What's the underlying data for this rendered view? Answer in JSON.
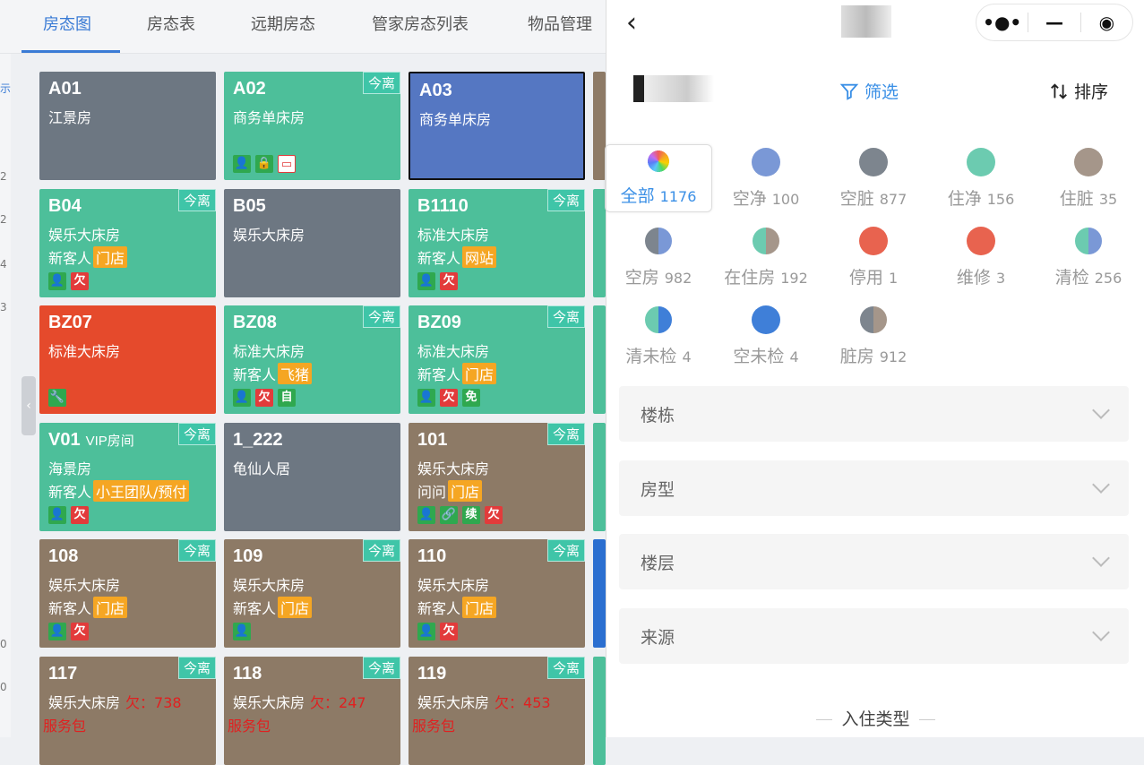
{
  "tabs": [
    {
      "label": "房态图",
      "active": true
    },
    {
      "label": "房态表"
    },
    {
      "label": "远期房态"
    },
    {
      "label": "管家房态列表"
    },
    {
      "label": "物品管理"
    }
  ],
  "left_strip_marks": [
    "示",
    "2",
    "2",
    "4",
    "3",
    "0",
    "0"
  ],
  "rooms": [
    {
      "no": "A01",
      "type": "江景房",
      "color": "gray"
    },
    {
      "no": "A02",
      "type": "商务单床房",
      "color": "green",
      "today": "今离",
      "icons": [
        "person",
        "lock",
        "card"
      ]
    },
    {
      "no": "A03",
      "type": "商务单床房",
      "color": "blue"
    },
    {
      "no": "B04",
      "type": "娱乐大床房",
      "color": "green",
      "today": "今离",
      "guest": "新客人",
      "source": "门店",
      "icons": [
        "person",
        "欠"
      ]
    },
    {
      "no": "B05",
      "type": "娱乐大床房",
      "color": "gray"
    },
    {
      "no": "B1110",
      "type": "标准大床房",
      "color": "green",
      "today": "今离",
      "guest": "新客人",
      "source": "网站",
      "icons": [
        "person",
        "欠"
      ]
    },
    {
      "no": "BZ07",
      "type": "标准大床房",
      "color": "red",
      "icons": [
        "wrench"
      ]
    },
    {
      "no": "BZ08",
      "type": "标准大床房",
      "color": "green",
      "today": "今离",
      "guest": "新客人",
      "source": "飞猪",
      "icons": [
        "person",
        "欠",
        "自"
      ]
    },
    {
      "no": "BZ09",
      "type": "标准大床房",
      "color": "green",
      "today": "今离",
      "guest": "新客人",
      "source": "门店",
      "icons": [
        "person",
        "欠",
        "免"
      ]
    },
    {
      "no": "V01",
      "no_sub": "VIP房间",
      "type": "海景房",
      "color": "green",
      "today": "今离",
      "guest": "新客人",
      "source": "小王团队/预付",
      "icons": [
        "person",
        "欠"
      ]
    },
    {
      "no": "1_222",
      "type": "龟仙人居",
      "color": "gray"
    },
    {
      "no": "101",
      "type": "娱乐大床房",
      "color": "brown",
      "today": "今离",
      "guest": "问问",
      "source": "门店",
      "icons": [
        "person",
        "link",
        "续",
        "欠"
      ]
    },
    {
      "no": "108",
      "type": "娱乐大床房",
      "color": "brown",
      "today": "今离",
      "guest": "新客人",
      "source": "门店",
      "icons": [
        "person",
        "欠"
      ]
    },
    {
      "no": "109",
      "type": "娱乐大床房",
      "color": "brown",
      "today": "今离",
      "guest": "新客人",
      "source": "门店",
      "icons": [
        "person"
      ]
    },
    {
      "no": "110",
      "type": "娱乐大床房",
      "color": "brown",
      "today": "今离",
      "guest": "新客人",
      "source": "门店",
      "icons": [
        "person",
        "欠"
      ]
    },
    {
      "no": "117",
      "type": "娱乐大床房",
      "color": "brown",
      "today": "今离",
      "debt": "欠：738",
      "package": "服务包"
    },
    {
      "no": "118",
      "type": "娱乐大床房",
      "color": "brown",
      "today": "今离",
      "debt": "欠：247",
      "package": "服务包"
    },
    {
      "no": "119",
      "type": "娱乐大床房",
      "color": "brown",
      "today": "今离",
      "debt": "欠：453",
      "package": "服务包"
    }
  ],
  "panel": {
    "filter_label": "筛选",
    "sort_label": "排序",
    "statuses": [
      {
        "label": "全部",
        "count": "1176",
        "selected": true,
        "dot": "rainbow"
      },
      {
        "label": "空净",
        "count": "100",
        "dot": "#7a98d6"
      },
      {
        "label": "空脏",
        "count": "877",
        "dot": "#7d858e"
      },
      {
        "label": "住净",
        "count": "156",
        "dot": "#6ccbb0"
      },
      {
        "label": "住脏",
        "count": "35",
        "dot": "#a5968a"
      },
      {
        "label": "空房",
        "count": "982",
        "dot": "split:#7d858e:#7a98d6"
      },
      {
        "label": "在住房",
        "count": "192",
        "dot": "split:#6ccbb0:#a5968a"
      },
      {
        "label": "停用",
        "count": "1",
        "dot": "#e8634f"
      },
      {
        "label": "维修",
        "count": "3",
        "dot": "#e8634f"
      },
      {
        "label": "清检",
        "count": "256",
        "dot": "split:#6ccbb0:#7a98d6"
      },
      {
        "label": "清未检",
        "count": "4",
        "dot": "split:#6ccbb0:#3f7fd8"
      },
      {
        "label": "空未检",
        "count": "4",
        "dot": "#3f7fd8"
      },
      {
        "label": "脏房",
        "count": "912",
        "dot": "split:#7d858e:#a5968a"
      }
    ],
    "accordions": [
      "楼栋",
      "房型",
      "楼层",
      "来源"
    ],
    "checkin_type_label": "入住类型",
    "capsule": {
      "more": "•●•",
      "minimize": "—",
      "close": "◉"
    }
  },
  "colors": {
    "accent": "#3a8fe6",
    "tab_active": "#3a7bd5"
  }
}
